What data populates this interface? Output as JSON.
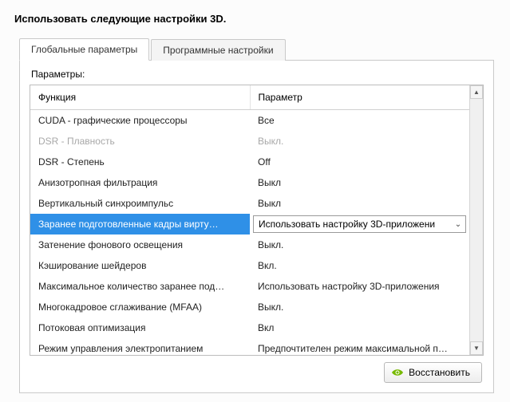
{
  "title": "Использовать следующие настройки 3D.",
  "tabs": {
    "global": "Глобальные параметры",
    "program": "Программные настройки"
  },
  "section_label": "Параметры:",
  "columns": {
    "function": "Функция",
    "param": "Параметр"
  },
  "rows": [
    {
      "fn": "CUDA - графические процессоры",
      "val": "Все"
    },
    {
      "fn": "DSR - Плавность",
      "val": "Выкл.",
      "disabled": true
    },
    {
      "fn": "DSR - Степень",
      "val": "Off"
    },
    {
      "fn": "Анизотропная фильтрация",
      "val": "Выкл"
    },
    {
      "fn": "Вертикальный синхроимпульс",
      "val": "Выкл"
    },
    {
      "fn": "Заранее подготовленные кадры вирту…",
      "val": "Использовать настройку 3D-приложени",
      "selected": true
    },
    {
      "fn": "Затенение фонового освещения",
      "val": "Выкл."
    },
    {
      "fn": "Кэширование шейдеров",
      "val": "Вкл."
    },
    {
      "fn": "Максимальное количество заранее под…",
      "val": "Использовать настройку 3D-приложения"
    },
    {
      "fn": "Многокадровое сглаживание (MFAA)",
      "val": "Выкл."
    },
    {
      "fn": "Потоковая оптимизация",
      "val": "Вкл"
    },
    {
      "fn": "Режим управления электропитанием",
      "val": "Предпочтителен режим максимальной п…"
    }
  ],
  "restore_label": "Восстановить"
}
